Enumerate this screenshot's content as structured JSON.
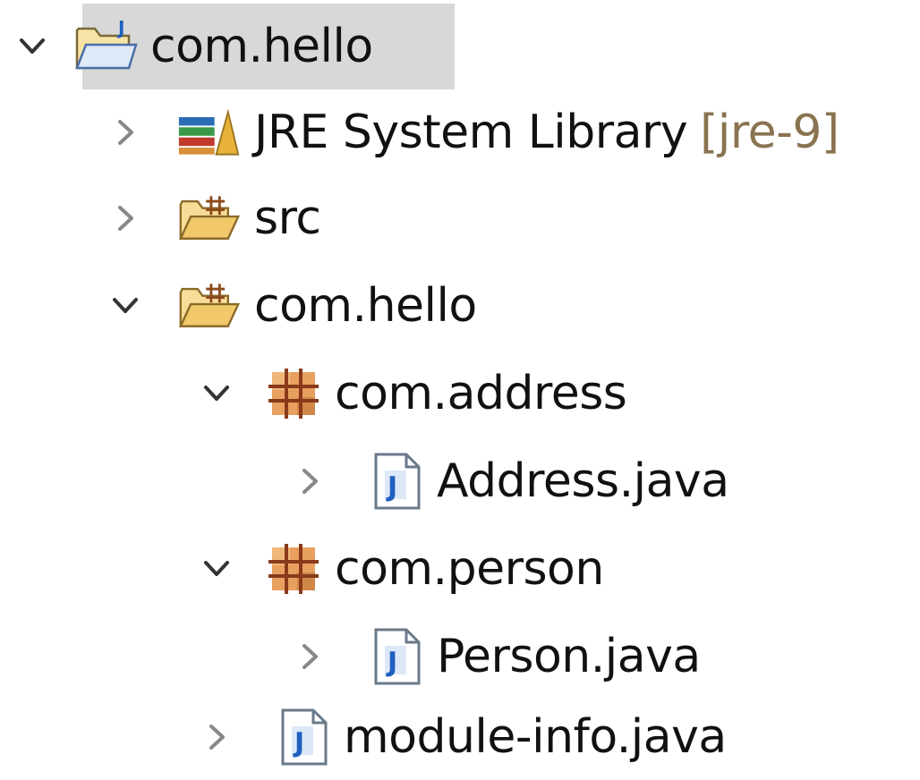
{
  "tree": {
    "project": {
      "label": "com.hello",
      "icon": "java-project-folder-icon",
      "expanded": true,
      "selected": true
    },
    "jre_library": {
      "label": "JRE System Library",
      "decoration": "[jre-9]",
      "icon": "library-books-icon",
      "expanded": false
    },
    "src_folder": {
      "label": "src",
      "icon": "source-folder-icon",
      "expanded": false
    },
    "module_folder": {
      "label": "com.hello",
      "icon": "source-folder-icon",
      "expanded": true
    },
    "package_address": {
      "label": "com.address",
      "icon": "package-icon",
      "expanded": true
    },
    "address_java": {
      "label": "Address.java",
      "icon": "java-file-icon",
      "expanded": false
    },
    "package_person": {
      "label": "com.person",
      "icon": "package-icon",
      "expanded": true
    },
    "person_java": {
      "label": "Person.java",
      "icon": "java-file-icon",
      "expanded": false
    },
    "module_info": {
      "label": "module-info.java",
      "icon": "java-file-icon",
      "expanded": false
    }
  },
  "colors": {
    "selection": "#d8d8d8",
    "text": "#111111",
    "decoration": "#8a7350",
    "chevron": "#555555",
    "package_brown": "#a0522d",
    "package_fill": "#e8a060",
    "folder_fill": "#f5d58a",
    "java_blue": "#1f5fbf"
  }
}
